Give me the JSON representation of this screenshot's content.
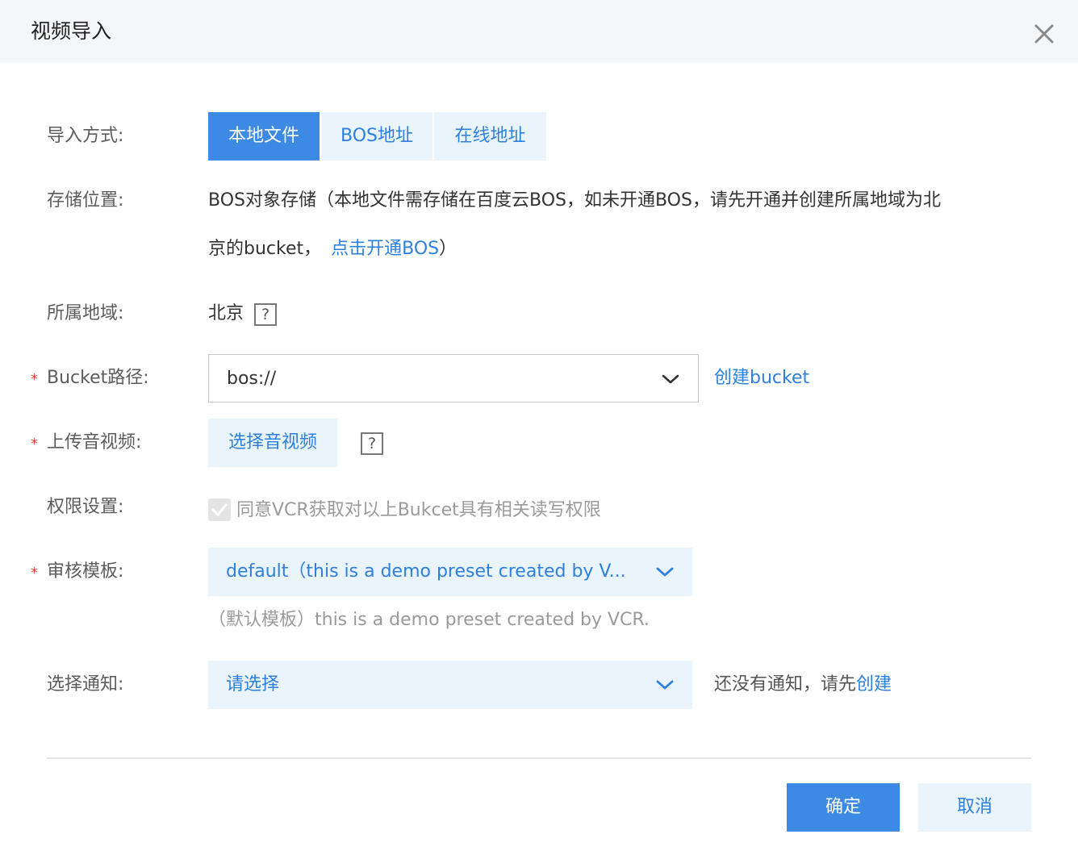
{
  "dialog": {
    "title": "视频导入"
  },
  "import_method": {
    "label": "导入方式:",
    "tabs": [
      {
        "label": "本地文件",
        "active": true
      },
      {
        "label": "BOS地址",
        "active": false
      },
      {
        "label": "在线地址",
        "active": false
      }
    ]
  },
  "storage": {
    "label": "存储位置:",
    "line1": "BOS对象存储（本地文件需存储在百度云BOS，如未开通BOS，请先开通并创建所属地域为北",
    "line2_prefix": "京的bucket，",
    "link": "点击开通BOS",
    "line2_suffix": "）"
  },
  "region": {
    "label": "所属地域:",
    "value": "北京",
    "help": "?"
  },
  "bucket": {
    "required_mark": "*",
    "label": "Bucket路径:",
    "value": "bos://",
    "create_link": "创建bucket"
  },
  "upload": {
    "required_mark": "*",
    "label": "上传音视频:",
    "button": "选择音视频",
    "help": "?"
  },
  "permission": {
    "label": "权限设置:",
    "checked": true,
    "text": "同意VCR获取对以上Bukcet具有相关读写权限"
  },
  "template": {
    "required_mark": "*",
    "label": "审核模板:",
    "value": "default（this is a demo preset created by V...",
    "hint": "（默认模板）this is a demo preset created by VCR."
  },
  "notify": {
    "label": "选择通知:",
    "placeholder": "请选择",
    "hint_prefix": "还没有通知，请先",
    "hint_link": "创建"
  },
  "footer": {
    "confirm": "确定",
    "cancel": "取消"
  },
  "colors": {
    "primary": "#3d8ae5",
    "link": "#2d7fe0",
    "light_bg": "#eaf4fd",
    "required": "#ea4335"
  }
}
